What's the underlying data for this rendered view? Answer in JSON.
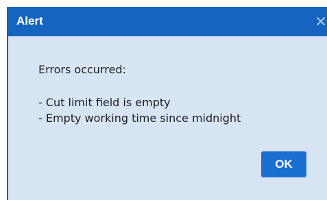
{
  "dialog": {
    "title": "Alert",
    "close_icon": "close-icon",
    "message": {
      "header": "Errors occurred:",
      "errors": [
        "- Cut limit field is empty",
        "- Empty working time since midnight"
      ]
    },
    "ok_label": "OK"
  },
  "colors": {
    "titlebar": "#1565c0",
    "body": "#d7e4f4",
    "button": "#1b6fd1",
    "text": "#1d1d1d"
  }
}
